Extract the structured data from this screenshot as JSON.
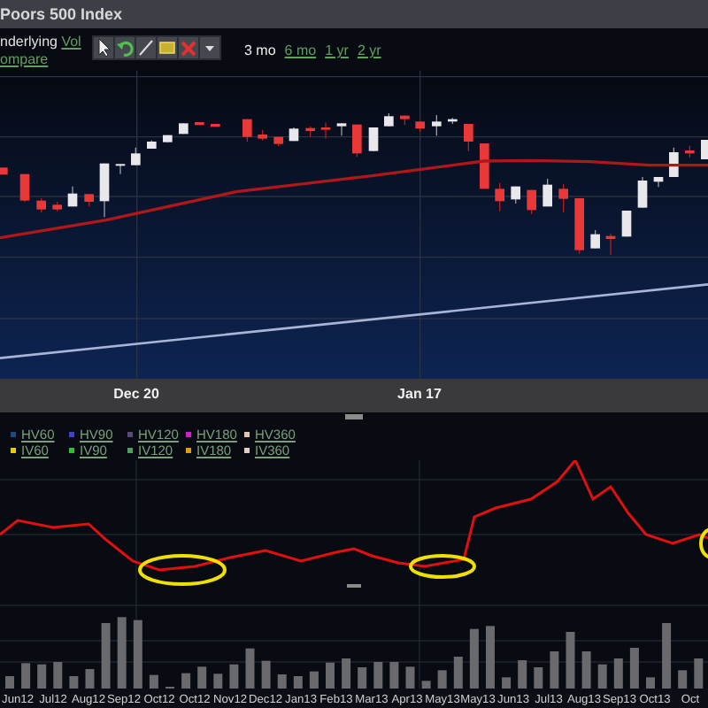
{
  "window": {
    "title": "Poors 500 Index"
  },
  "toolbar": {
    "label": "nderlying",
    "links": [
      "Vol",
      "ompare"
    ],
    "periods": [
      {
        "label": "3 mo",
        "selected": true
      },
      {
        "label": "6 mo",
        "selected": false
      },
      {
        "label": "1 yr",
        "selected": false
      },
      {
        "label": "2 yr",
        "selected": false
      }
    ]
  },
  "price_chart": {
    "x_labels": [
      "Dec 20",
      "Jan 17"
    ]
  },
  "legend": {
    "rows": [
      [
        {
          "label": "HV60",
          "color": "#1f4a80"
        },
        {
          "label": "HV90",
          "color": "#4040c8"
        },
        {
          "label": "HV120",
          "color": "#5a4a78"
        },
        {
          "label": "HV180",
          "color": "#d020c8"
        },
        {
          "label": "HV360",
          "color": "#e0c8b0"
        }
      ],
      [
        {
          "label": "IV60",
          "color": "#e0d000"
        },
        {
          "label": "IV90",
          "color": "#30c030"
        },
        {
          "label": "IV120",
          "color": "#50a060"
        },
        {
          "label": "IV180",
          "color": "#e0a000"
        },
        {
          "label": "IV360",
          "color": "#e0d0c0"
        }
      ]
    ]
  },
  "volume_chart": {
    "x_labels": [
      "Jun12",
      "Jul12",
      "Aug12",
      "Sep12",
      "Oct12",
      "Oct12",
      "Nov12",
      "Dec12",
      "Jan13",
      "Feb13",
      "Mar13",
      "Apr13",
      "May13",
      "May13",
      "Jun13",
      "Jul13",
      "Aug13",
      "Sep13",
      "Oct13",
      "Oct"
    ]
  }
}
